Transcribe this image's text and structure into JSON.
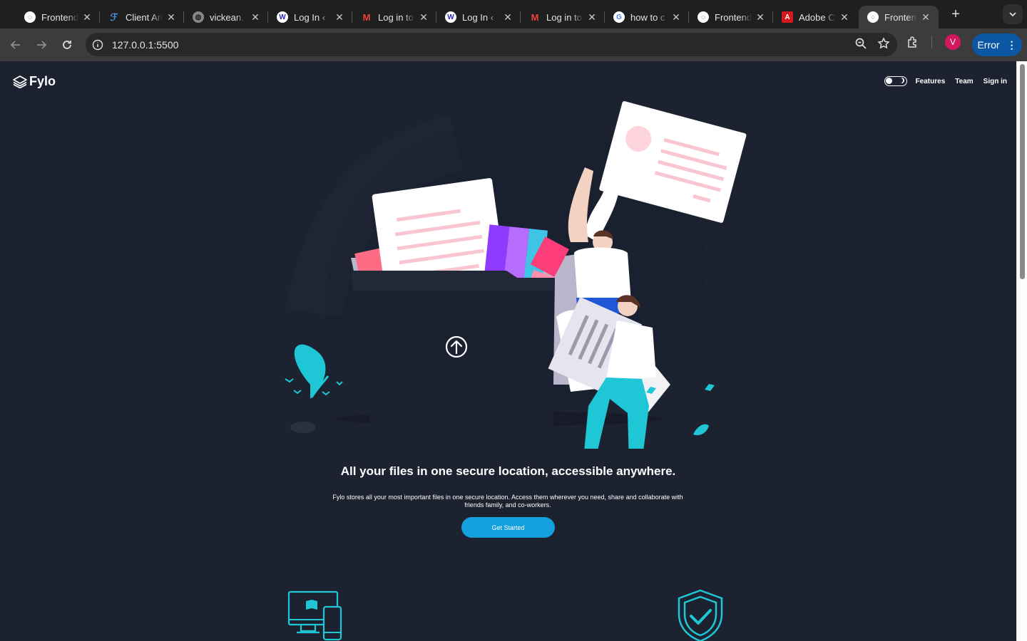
{
  "browser": {
    "tabs": [
      {
        "title": "Frontend Mentor",
        "favicon": "globe",
        "active": false
      },
      {
        "title": "Client Area",
        "favicon": "client",
        "active": false
      },
      {
        "title": "vickean.",
        "favicon": "globe",
        "active": false
      },
      {
        "title": "Log In ‹",
        "favicon": "wordpress",
        "active": false
      },
      {
        "title": "Log in to",
        "favicon": "gmail",
        "active": false
      },
      {
        "title": "Log In ‹",
        "favicon": "wordpress",
        "active": false
      },
      {
        "title": "Log in to",
        "favicon": "gmail",
        "active": false
      },
      {
        "title": "how to c",
        "favicon": "google",
        "active": false
      },
      {
        "title": "Frontend",
        "favicon": "globe",
        "active": false
      },
      {
        "title": "Adobe C",
        "favicon": "adobe",
        "active": false
      },
      {
        "title": "Frontend",
        "favicon": "globe",
        "active": true
      }
    ],
    "url": "127.0.0.1:5500",
    "profile_initial": "V",
    "error_label": "Error"
  },
  "page": {
    "logo": "Fylo",
    "nav": [
      "Features",
      "Team",
      "Sign in"
    ],
    "headline": "All your files in one secure location, accessible anywhere.",
    "subtext": "Fylo stores all your most important files in one secure location. Access them wherever you need, share and collaborate with friends family, and co-workers.",
    "cta": "Get Started",
    "colors": {
      "background": "#1c2230",
      "accent": "#14a0dc",
      "teal": "#1fc6d5",
      "pink": "#fc6d85"
    }
  }
}
